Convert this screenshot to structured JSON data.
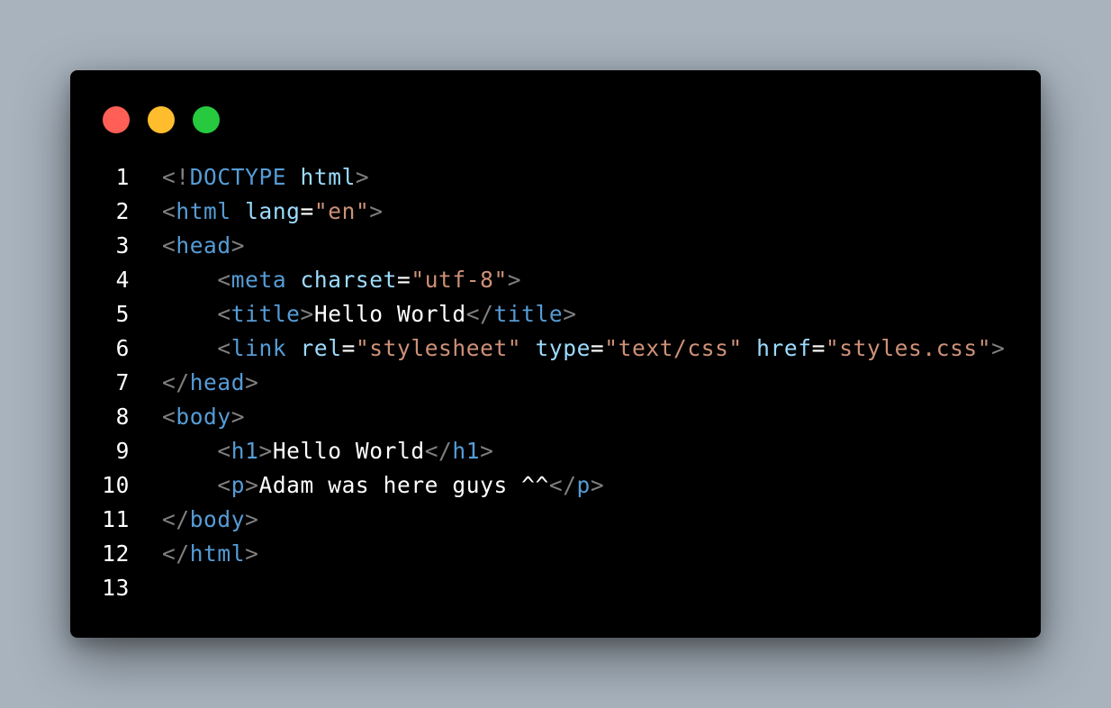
{
  "colors": {
    "background": "#a8b3be",
    "window": "#000000",
    "red": "#ff5f56",
    "yellow": "#ffbd2e",
    "green": "#27c93f",
    "punct": "#808080",
    "tag": "#569cd6",
    "attr": "#9cdcfe",
    "string": "#ce9178",
    "text": "#ffffff"
  },
  "window_controls": [
    {
      "name": "close",
      "icon": "red-circle-icon"
    },
    {
      "name": "minimize",
      "icon": "yellow-circle-icon"
    },
    {
      "name": "maximize",
      "icon": "green-circle-icon"
    }
  ],
  "code": {
    "language": "html",
    "lines": [
      {
        "number": "1",
        "indent": "",
        "tokens": [
          {
            "t": "punct",
            "v": "<!"
          },
          {
            "t": "tag",
            "v": "DOCTYPE"
          },
          {
            "t": "text",
            "v": " "
          },
          {
            "t": "attr",
            "v": "html"
          },
          {
            "t": "punct",
            "v": ">"
          }
        ]
      },
      {
        "number": "2",
        "indent": "",
        "tokens": [
          {
            "t": "punct",
            "v": "<"
          },
          {
            "t": "tag",
            "v": "html"
          },
          {
            "t": "text",
            "v": " "
          },
          {
            "t": "attr",
            "v": "lang"
          },
          {
            "t": "text",
            "v": "="
          },
          {
            "t": "str",
            "v": "\"en\""
          },
          {
            "t": "punct",
            "v": ">"
          }
        ]
      },
      {
        "number": "3",
        "indent": "",
        "tokens": [
          {
            "t": "punct",
            "v": "<"
          },
          {
            "t": "tag",
            "v": "head"
          },
          {
            "t": "punct",
            "v": ">"
          }
        ]
      },
      {
        "number": "4",
        "indent": "    ",
        "tokens": [
          {
            "t": "punct",
            "v": "<"
          },
          {
            "t": "tag",
            "v": "meta"
          },
          {
            "t": "text",
            "v": " "
          },
          {
            "t": "attr",
            "v": "charset"
          },
          {
            "t": "text",
            "v": "="
          },
          {
            "t": "str",
            "v": "\"utf-8\""
          },
          {
            "t": "punct",
            "v": ">"
          }
        ]
      },
      {
        "number": "5",
        "indent": "    ",
        "tokens": [
          {
            "t": "punct",
            "v": "<"
          },
          {
            "t": "tag",
            "v": "title"
          },
          {
            "t": "punct",
            "v": ">"
          },
          {
            "t": "text",
            "v": "Hello World"
          },
          {
            "t": "punct",
            "v": "</"
          },
          {
            "t": "tag",
            "v": "title"
          },
          {
            "t": "punct",
            "v": ">"
          }
        ]
      },
      {
        "number": "6",
        "indent": "    ",
        "tokens": [
          {
            "t": "punct",
            "v": "<"
          },
          {
            "t": "tag",
            "v": "link"
          },
          {
            "t": "text",
            "v": " "
          },
          {
            "t": "attr",
            "v": "rel"
          },
          {
            "t": "text",
            "v": "="
          },
          {
            "t": "str",
            "v": "\"stylesheet\""
          },
          {
            "t": "text",
            "v": " "
          },
          {
            "t": "attr",
            "v": "type"
          },
          {
            "t": "text",
            "v": "="
          },
          {
            "t": "str",
            "v": "\"text/css\""
          },
          {
            "t": "text",
            "v": " "
          },
          {
            "t": "attr",
            "v": "href"
          },
          {
            "t": "text",
            "v": "="
          },
          {
            "t": "str",
            "v": "\"styles.css\""
          },
          {
            "t": "punct",
            "v": ">"
          }
        ]
      },
      {
        "number": "7",
        "indent": "",
        "tokens": [
          {
            "t": "punct",
            "v": "</"
          },
          {
            "t": "tag",
            "v": "head"
          },
          {
            "t": "punct",
            "v": ">"
          }
        ]
      },
      {
        "number": "8",
        "indent": "",
        "tokens": [
          {
            "t": "punct",
            "v": "<"
          },
          {
            "t": "tag",
            "v": "body"
          },
          {
            "t": "punct",
            "v": ">"
          }
        ]
      },
      {
        "number": "9",
        "indent": "    ",
        "tokens": [
          {
            "t": "punct",
            "v": "<"
          },
          {
            "t": "tag",
            "v": "h1"
          },
          {
            "t": "punct",
            "v": ">"
          },
          {
            "t": "text",
            "v": "Hello World"
          },
          {
            "t": "punct",
            "v": "</"
          },
          {
            "t": "tag",
            "v": "h1"
          },
          {
            "t": "punct",
            "v": ">"
          }
        ]
      },
      {
        "number": "10",
        "indent": "    ",
        "tokens": [
          {
            "t": "punct",
            "v": "<"
          },
          {
            "t": "tag",
            "v": "p"
          },
          {
            "t": "punct",
            "v": ">"
          },
          {
            "t": "text",
            "v": "Adam was here guys ^^"
          },
          {
            "t": "punct",
            "v": "</"
          },
          {
            "t": "tag",
            "v": "p"
          },
          {
            "t": "punct",
            "v": ">"
          }
        ]
      },
      {
        "number": "11",
        "indent": "",
        "tokens": [
          {
            "t": "punct",
            "v": "</"
          },
          {
            "t": "tag",
            "v": "body"
          },
          {
            "t": "punct",
            "v": ">"
          }
        ]
      },
      {
        "number": "12",
        "indent": "",
        "tokens": [
          {
            "t": "punct",
            "v": "</"
          },
          {
            "t": "tag",
            "v": "html"
          },
          {
            "t": "punct",
            "v": ">"
          }
        ]
      },
      {
        "number": "13",
        "indent": "",
        "tokens": []
      }
    ]
  }
}
